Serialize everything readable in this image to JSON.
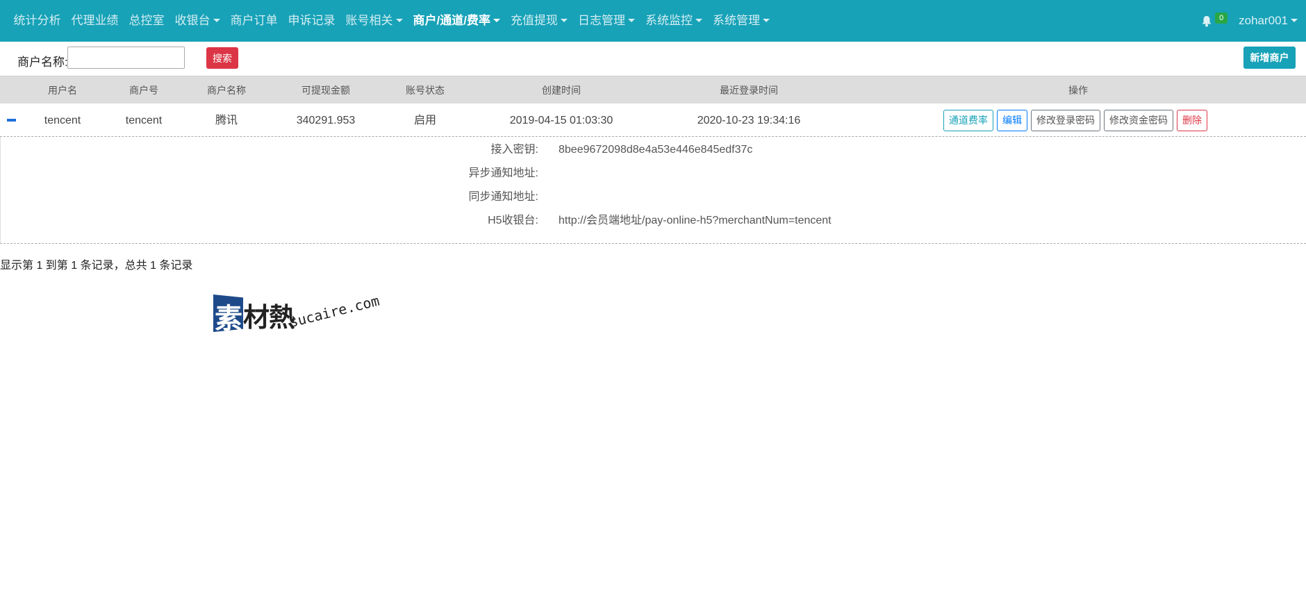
{
  "nav": {
    "items": [
      {
        "label": "统计分析",
        "dropdown": false,
        "active": false
      },
      {
        "label": "代理业绩",
        "dropdown": false,
        "active": false
      },
      {
        "label": "总控室",
        "dropdown": false,
        "active": false
      },
      {
        "label": "收银台",
        "dropdown": true,
        "active": false
      },
      {
        "label": "商户订单",
        "dropdown": false,
        "active": false
      },
      {
        "label": "申诉记录",
        "dropdown": false,
        "active": false
      },
      {
        "label": "账号相关",
        "dropdown": true,
        "active": false
      },
      {
        "label": "商户/通道/费率",
        "dropdown": true,
        "active": true
      },
      {
        "label": "充值提现",
        "dropdown": true,
        "active": false
      },
      {
        "label": "日志管理",
        "dropdown": true,
        "active": false
      },
      {
        "label": "系统监控",
        "dropdown": true,
        "active": false
      },
      {
        "label": "系统管理",
        "dropdown": true,
        "active": false
      }
    ],
    "notification_count": "0",
    "username": "zohar001",
    "bar_color": "#17a2b8"
  },
  "search": {
    "label": "商户名称:",
    "value": "",
    "placeholder": "",
    "button_label": "搜索",
    "add_button_label": "新增商户"
  },
  "table": {
    "headers": [
      "用户名",
      "商户号",
      "商户名称",
      "可提现金额",
      "账号状态",
      "创建时间",
      "最近登录时间",
      "操作"
    ],
    "rows": [
      {
        "username": "tencent",
        "merchant_no": "tencent",
        "merchant_name": "腾讯",
        "withdrawable": "340291.953",
        "status": "启用",
        "created": "2019-04-15 01:03:30",
        "last_login": "2020-10-23 19:34:16"
      }
    ],
    "actions": {
      "channel_rate": "通道费率",
      "edit": "编辑",
      "change_login_pwd": "修改登录密码",
      "change_fund_pwd": "修改资金密码",
      "delete": "删除"
    }
  },
  "detail": {
    "access_key_label": "接入密钥:",
    "access_key_value": "8bee9672098d8e4a53e446e845edf37c",
    "async_notify_label": "异步通知地址:",
    "async_notify_value": "",
    "sync_notify_label": "同步通知地址:",
    "sync_notify_value": "",
    "h5_cashier_label": "H5收银台:",
    "h5_cashier_value": "http://会员端地址/pay-online-h5?merchantNum=tencent"
  },
  "pagination": {
    "info": "显示第 1 到第 1 条记录，总共 1 条记录"
  },
  "watermark": {
    "first_char": "素",
    "rest_chars": "材熱",
    "url": "sucaire.com"
  }
}
